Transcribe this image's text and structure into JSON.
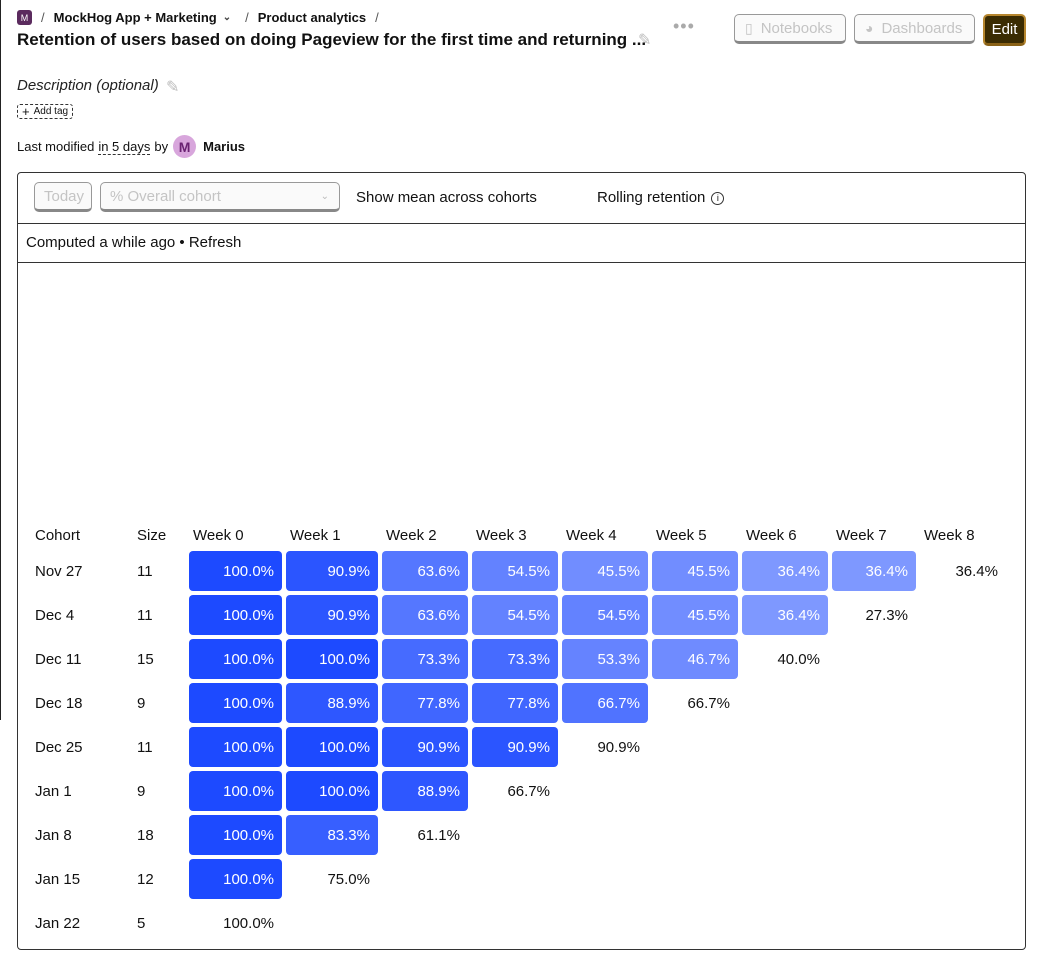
{
  "breadcrumbs": {
    "org_initial": "M",
    "project": "MockHog App + Marketing",
    "section": "Product analytics"
  },
  "title": "Retention of users based on doing Pageview for the first time and returning ...",
  "header_buttons": {
    "notebooks": "Notebooks",
    "dashboards": "Dashboards",
    "edit": "Edit"
  },
  "description_placeholder": "Description (optional)",
  "add_tag": "Add tag",
  "modified": {
    "prefix": "Last modified",
    "when": "in 5 days",
    "by": "by",
    "user_initial": "M",
    "user": "Marius"
  },
  "toolbar": {
    "date_button": "Today",
    "cohort_select": "% Overall cohort",
    "show_mean": "Show mean across cohorts",
    "rolling": "Rolling retention"
  },
  "status": "Computed a while ago • Refresh",
  "table": {
    "columns": [
      "Cohort",
      "Size",
      "Week 0",
      "Week 1",
      "Week 2",
      "Week 3",
      "Week 4",
      "Week 5",
      "Week 6",
      "Week 7",
      "Week 8"
    ],
    "rows": [
      {
        "cohort": "Nov 27",
        "size": "11",
        "values": [
          "100.0%",
          "90.9%",
          "63.6%",
          "54.5%",
          "45.5%",
          "45.5%",
          "36.4%",
          "36.4%",
          "36.4%"
        ]
      },
      {
        "cohort": "Dec 4",
        "size": "11",
        "values": [
          "100.0%",
          "90.9%",
          "63.6%",
          "54.5%",
          "54.5%",
          "45.5%",
          "36.4%",
          "27.3%"
        ]
      },
      {
        "cohort": "Dec 11",
        "size": "15",
        "values": [
          "100.0%",
          "100.0%",
          "73.3%",
          "73.3%",
          "53.3%",
          "46.7%",
          "40.0%"
        ]
      },
      {
        "cohort": "Dec 18",
        "size": "9",
        "values": [
          "100.0%",
          "88.9%",
          "77.8%",
          "77.8%",
          "66.7%",
          "66.7%"
        ]
      },
      {
        "cohort": "Dec 25",
        "size": "11",
        "values": [
          "100.0%",
          "100.0%",
          "90.9%",
          "90.9%",
          "90.9%"
        ]
      },
      {
        "cohort": "Jan 1",
        "size": "9",
        "values": [
          "100.0%",
          "100.0%",
          "88.9%",
          "66.7%"
        ]
      },
      {
        "cohort": "Jan 8",
        "size": "18",
        "values": [
          "100.0%",
          "83.3%",
          "61.1%"
        ]
      },
      {
        "cohort": "Jan 15",
        "size": "12",
        "values": [
          "100.0%",
          "75.0%"
        ]
      },
      {
        "cohort": "Jan 22",
        "size": "5",
        "values": [
          "100.0%"
        ]
      }
    ]
  }
}
